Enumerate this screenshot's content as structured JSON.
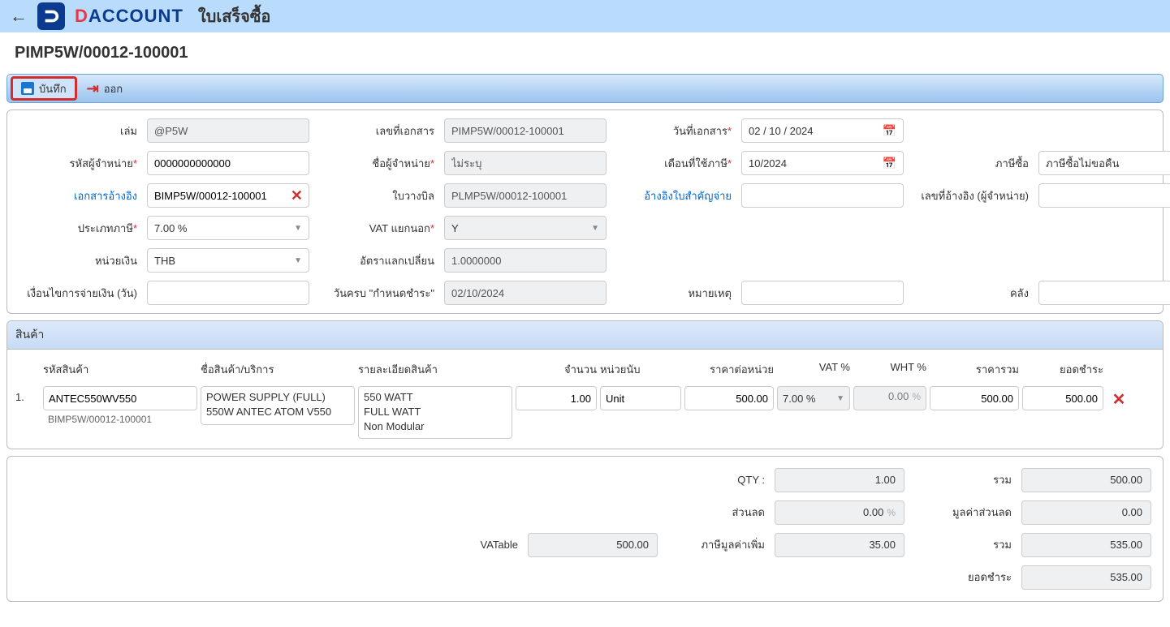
{
  "header": {
    "brand_prefix": "D",
    "brand_rest": "ACCOUNT",
    "page_type": "ใบเสร็จซื้อ"
  },
  "doc_title": "PIMP5W/00012-100001",
  "toolbar": {
    "save": "บันทึก",
    "exit": "ออก"
  },
  "form": {
    "book_label": "เล่ม",
    "book_value": "@P5W",
    "doc_no_label": "เลขที่เอกสาร",
    "doc_no_value": "PIMP5W/00012-100001",
    "doc_date_label": "วันที่เอกสาร",
    "doc_date_value": "02 / 10 / 2024",
    "vendor_code_label": "รหัสผู้จำหน่าย",
    "vendor_code_value": "0000000000000",
    "vendor_name_label": "ชื่อผู้จำหน่าย",
    "vendor_name_value": "ไม่ระบุ",
    "tax_month_label": "เดือนที่ใช้ภาษี",
    "tax_month_value": "10/2024",
    "purchase_tax_label": "ภาษีซื้อ",
    "purchase_tax_value": "ภาษีซื้อไม่ขอคืน",
    "ref_doc_label": "เอกสารอ้างอิง",
    "ref_doc_value": "BIMP5W/00012-100001",
    "bill_label": "ใบวางบิล",
    "bill_value": "PLMP5W/00012-100001",
    "payment_ref_label": "อ้างอิงใบสำคัญจ่าย",
    "payment_ref_value": "",
    "vendor_ref_label": "เลขที่อ้างอิง (ผู้จำหน่าย)",
    "vendor_ref_value": "",
    "tax_type_label": "ประเภทภาษี",
    "tax_type_value": "7.00 %",
    "vat_sep_label": "VAT แยกนอก",
    "vat_sep_value": "Y",
    "currency_label": "หน่วยเงิน",
    "currency_value": "THB",
    "exrate_label": "อัตราแลกเปลี่ยน",
    "exrate_value": "1.0000000",
    "credit_label": "เงื่อนไขการจ่ายเงิน (วัน)",
    "credit_value": "",
    "due_label": "วันครบ \"กำหนดชำระ\"",
    "due_value": "02/10/2024",
    "remark_label": "หมายเหตุ",
    "remark_value": "",
    "warehouse_label": "คลัง",
    "warehouse_value": ""
  },
  "items": {
    "section_title": "สินค้า",
    "cols": {
      "code": "รหัสสินค้า",
      "name": "ชื่อสินค้า/บริการ",
      "detail": "รายละเอียดสินค้า",
      "qty": "จำนวน",
      "unit": "หน่วยนับ",
      "unit_price": "ราคาต่อหน่วย",
      "vat": "VAT %",
      "wht": "WHT %",
      "total": "ราคารวม",
      "pay": "ยอดชำระ"
    },
    "rows": [
      {
        "no": "1.",
        "code": "ANTEC550WV550",
        "code_sub": "BIMP5W/00012-100001",
        "name": "POWER SUPPLY (FULL) 550W ANTEC ATOM V550",
        "detail": "550 WATT\nFULL WATT\nNon Modular",
        "qty": "1.00",
        "unit": "Unit",
        "unit_price": "500.00",
        "vat": "7.00 %",
        "wht": "0.00",
        "wht_suffix": "%",
        "total": "500.00",
        "pay": "500.00"
      }
    ]
  },
  "totals": {
    "qty_label": "QTY :",
    "qty_value": "1.00",
    "sum_label": "รวม",
    "sum_value": "500.00",
    "discount_label": "ส่วนลด",
    "discount_value": "0.00",
    "discount_suffix": "%",
    "discount_amt_label": "มูลค่าส่วนลด",
    "discount_amt_value": "0.00",
    "vatable_label": "VATable",
    "vatable_value": "500.00",
    "vat_label": "ภาษีมูลค่าเพิ่ม",
    "vat_value": "35.00",
    "grand_label": "รวม",
    "grand_value": "535.00",
    "net_label": "ยอดชำระ",
    "net_value": "535.00"
  }
}
